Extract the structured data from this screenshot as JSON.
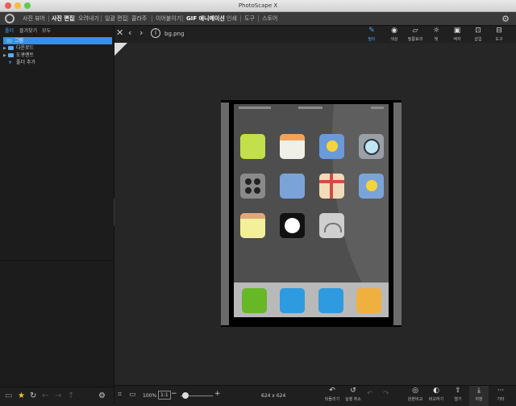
{
  "window": {
    "title": "PhotoScape X"
  },
  "menu": {
    "items": [
      "사진 뷰어",
      "사진 편집",
      "오려내기",
      "일괄 편집",
      "콜라주",
      "이어붙이기",
      "GIF 애니메이션",
      "인쇄",
      "도구",
      "스토어"
    ],
    "active_index": 1
  },
  "left_panel": {
    "tabs": [
      "폴더",
      "즐겨찾기",
      "모두"
    ],
    "tree": [
      {
        "label": "그림",
        "type": "folder",
        "selected": true,
        "expandable": false
      },
      {
        "label": "다운로드",
        "type": "folder",
        "selected": false,
        "expandable": true
      },
      {
        "label": "도큐멘트",
        "type": "folder",
        "selected": false,
        "expandable": true
      },
      {
        "label": "폴더 추가",
        "type": "add",
        "selected": false,
        "expandable": false
      }
    ]
  },
  "file": {
    "name": "bg.png",
    "dimensions": "624 x 624"
  },
  "toolbar": {
    "tools": [
      {
        "label": "필터",
        "icon": "pencil-icon",
        "active": true
      },
      {
        "label": "색상",
        "icon": "circle-icon",
        "active": false
      },
      {
        "label": "필름효과",
        "icon": "sticky-note-icon",
        "active": false
      },
      {
        "label": "빛",
        "icon": "sun-icon",
        "active": false
      },
      {
        "label": "액자",
        "icon": "frame-icon",
        "active": false
      },
      {
        "label": "삽입",
        "icon": "insert-icon",
        "active": false
      },
      {
        "label": "도구",
        "icon": "tools-icon",
        "active": false
      }
    ]
  },
  "bottom": {
    "zoom": "100%",
    "zoom_mode": "1:1",
    "zoom_level": 0.1,
    "tools": [
      {
        "label": "되돌리기",
        "icon": "undo-icon"
      },
      {
        "label": "실행 취소",
        "icon": "redo-icon"
      },
      {
        "label": "원본비교",
        "icon": "compare-icon"
      },
      {
        "label": "비교하기",
        "icon": "compare2-icon"
      },
      {
        "label": "열기",
        "icon": "upload-icon"
      },
      {
        "label": "저장",
        "icon": "save-icon"
      },
      {
        "label": "기타",
        "icon": "more-icon"
      }
    ]
  },
  "colors": {
    "accent": "#3a8ee6",
    "apps": [
      "#c3df4a",
      "#f0efe8",
      "#6a9ad8",
      "#9aa0a8",
      "#8a8a8a",
      "#7aa4d8",
      "#f0dcb8",
      "#7aa4d8",
      "#f4ef9a",
      "#111111",
      "#cfcfcf"
    ],
    "dock": [
      "#66b826",
      "#2e9be0",
      "#2e9be0",
      "#f0b040"
    ]
  }
}
